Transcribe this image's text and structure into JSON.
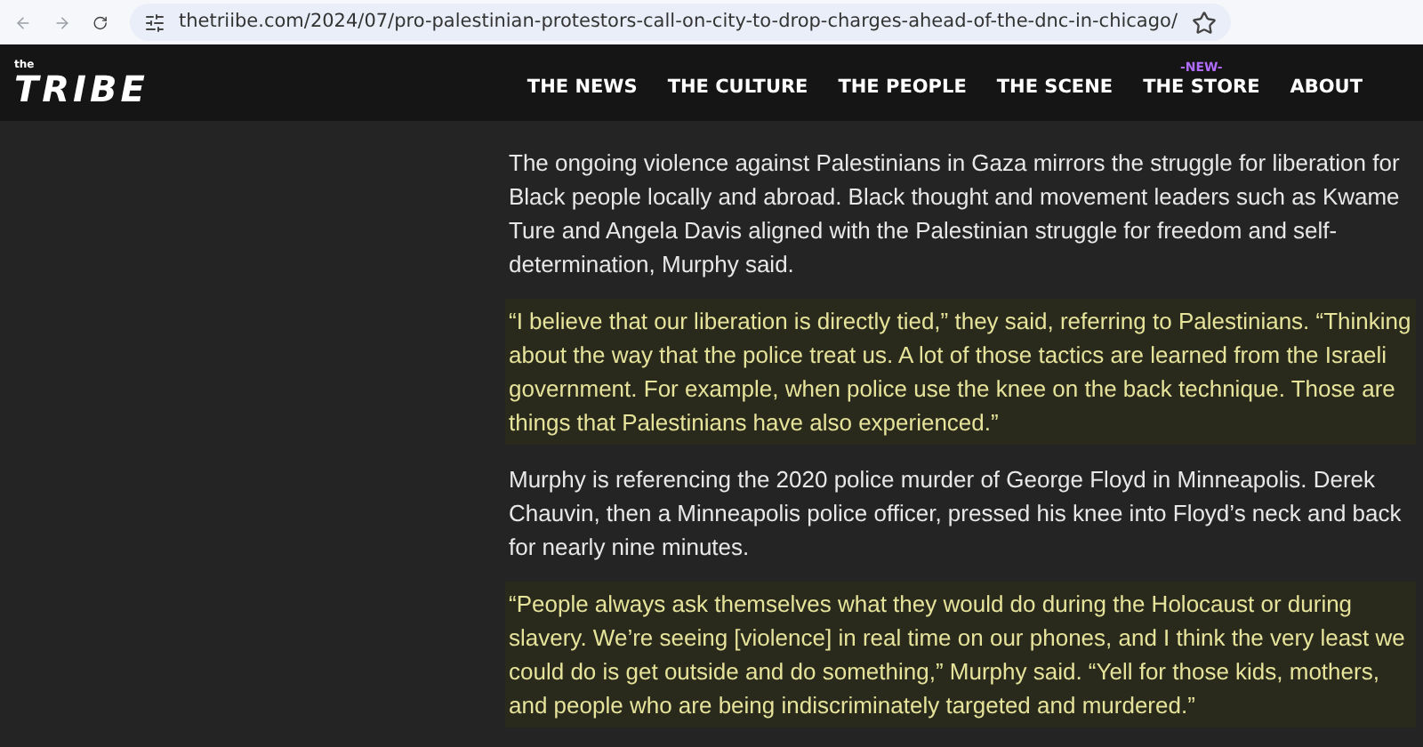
{
  "browser": {
    "url": "thetriibe.com/2024/07/pro-palestinian-protestors-call-on-city-to-drop-charges-ahead-of-the-dnc-in-chicago/"
  },
  "site": {
    "logo_small": "the",
    "logo": "TRIBE"
  },
  "nav": [
    {
      "label": "THE NEWS"
    },
    {
      "label": "THE CULTURE"
    },
    {
      "label": "THE PEOPLE"
    },
    {
      "label": "THE SCENE"
    },
    {
      "label": "THE STORE",
      "badge": "-NEW-"
    },
    {
      "label": "ABOUT"
    }
  ],
  "article": {
    "paragraphs": [
      {
        "kind": "text",
        "text": "The ongoing violence against Palestinians in Gaza mirrors the struggle for liberation for Black people locally and abroad. Black thought and movement leaders such as Kwame Ture and Angela Davis aligned with the Palestinian struggle for freedom and self-determination, Murphy said."
      },
      {
        "kind": "quote",
        "text": "“I believe that our liberation is directly tied,” they said, referring to Palestinians. “Thinking about the way that the police treat us. A lot of those tactics are learned from the Israeli government. For example, when police use the knee on the back technique. Those are things that Palestinians have also experienced.”"
      },
      {
        "kind": "text",
        "text": "Murphy is referencing the 2020 police murder of George Floyd in Minneapolis. Derek Chauvin, then a Minneapolis police officer, pressed his knee into Floyd’s neck and back for nearly nine minutes."
      },
      {
        "kind": "quote",
        "text": "“People always ask themselves what they would do during the Holocaust or during slavery. We’re seeing [violence] in real time on our phones, and I think the very least we could do is get outside and do something,” Murphy said. “Yell for those kids, mothers, and people who are being indiscriminately targeted and murdered.”"
      }
    ]
  }
}
